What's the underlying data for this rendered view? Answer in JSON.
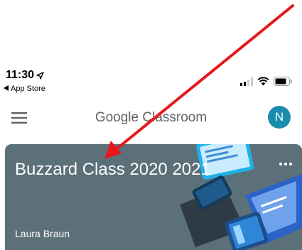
{
  "status_bar": {
    "time": "11:30",
    "back_label": "App Store",
    "icons": [
      "location-arrow-icon",
      "signal-icon",
      "wifi-icon",
      "battery-icon"
    ]
  },
  "app_bar": {
    "title": "Google Classroom",
    "menu_icon": "hamburger-menu-icon",
    "avatar_letter": "N",
    "avatar_color": "#1a8cae"
  },
  "class_card": {
    "name": "Buzzard Class 2020 2021",
    "teacher": "Laura Braun",
    "background_color": "#5b7078",
    "more_icon": "more-horizontal-icon"
  },
  "annotation": {
    "color": "#e8171b",
    "icon": "red-pointer-arrow"
  }
}
